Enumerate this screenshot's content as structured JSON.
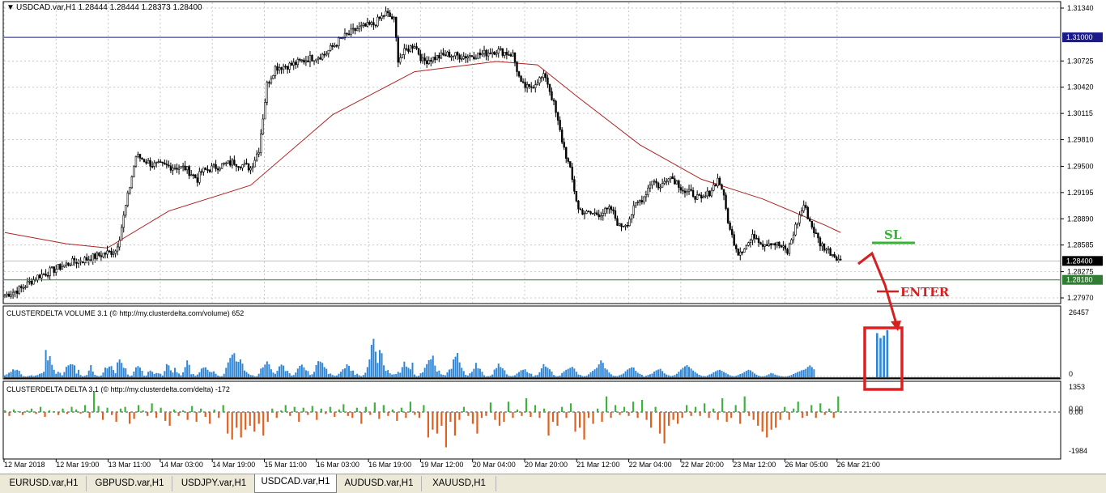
{
  "window": {
    "symbol_header": "USDCAD.var,H1  1.28444 1.28444 1.28373 1.28400"
  },
  "tabs": [
    {
      "label": "EURUSD.var,H1",
      "active": false
    },
    {
      "label": "GBPUSD.var,H1",
      "active": false
    },
    {
      "label": "USDJPY.var,H1",
      "active": false
    },
    {
      "label": "USDCAD.var,H1",
      "active": true
    },
    {
      "label": "AUDUSD.var,H1",
      "active": false
    },
    {
      "label": "XAUUSD,H1",
      "active": false
    }
  ],
  "chart_data": [
    {
      "type": "candlestick",
      "symbol": "USDCAD.var",
      "timeframe": "H1",
      "ohlc_last": {
        "open": 1.28444,
        "high": 1.28444,
        "low": 1.28373,
        "close": 1.284
      },
      "ylim": [
        1.2797,
        1.3134
      ],
      "y_ticks": [
        "1.31340",
        "1.31000",
        "1.30725",
        "1.30420",
        "1.30115",
        "1.29810",
        "1.29500",
        "1.29195",
        "1.28890",
        "1.28585",
        "1.28400",
        "1.28275",
        "1.28180",
        "1.27970"
      ],
      "x_ticks": [
        "12 Mar 2018",
        "12 Mar 19:00",
        "13 Mar 11:00",
        "14 Mar 03:00",
        "14 Mar 19:00",
        "15 Mar 11:00",
        "16 Mar 03:00",
        "16 Mar 19:00",
        "19 Mar 12:00",
        "20 Mar 04:00",
        "20 Mar 20:00",
        "21 Mar 12:00",
        "22 Mar 04:00",
        "22 Mar 20:00",
        "23 Mar 12:00",
        "26 Mar 05:00",
        "26 Mar 21:00"
      ],
      "close_path": [
        [
          0,
          1.28
        ],
        [
          8,
          1.2808
        ],
        [
          16,
          1.2822
        ],
        [
          24,
          1.283
        ],
        [
          32,
          1.2838
        ],
        [
          40,
          1.2842
        ],
        [
          48,
          1.2848
        ],
        [
          54,
          1.2852
        ],
        [
          56,
          1.2868
        ],
        [
          60,
          1.2915
        ],
        [
          64,
          1.2962
        ],
        [
          66,
          1.296
        ],
        [
          72,
          1.2952
        ],
        [
          80,
          1.295
        ],
        [
          88,
          1.2948
        ],
        [
          94,
          1.2935
        ],
        [
          96,
          1.2944
        ],
        [
          104,
          1.295
        ],
        [
          112,
          1.2955
        ],
        [
          120,
          1.2948
        ],
        [
          124,
          1.297
        ],
        [
          128,
          1.3045
        ],
        [
          132,
          1.3065
        ],
        [
          140,
          1.3068
        ],
        [
          148,
          1.3075
        ],
        [
          156,
          1.308
        ],
        [
          164,
          1.3098
        ],
        [
          172,
          1.311
        ],
        [
          180,
          1.3115
        ],
        [
          186,
          1.3128
        ],
        [
          190,
          1.312
        ],
        [
          192,
          1.3075
        ],
        [
          196,
          1.3085
        ],
        [
          200,
          1.3092
        ],
        [
          204,
          1.3072
        ],
        [
          208,
          1.3075
        ],
        [
          216,
          1.308
        ],
        [
          224,
          1.3078
        ],
        [
          232,
          1.308
        ],
        [
          240,
          1.3085
        ],
        [
          248,
          1.308
        ],
        [
          252,
          1.3045
        ],
        [
          256,
          1.304
        ],
        [
          260,
          1.305
        ],
        [
          264,
          1.3055
        ],
        [
          268,
          1.3022
        ],
        [
          272,
          1.298
        ],
        [
          276,
          1.2945
        ],
        [
          280,
          1.29
        ],
        [
          284,
          1.2895
        ],
        [
          290,
          1.2895
        ],
        [
          296,
          1.29
        ],
        [
          300,
          1.288
        ],
        [
          304,
          1.2885
        ],
        [
          308,
          1.2905
        ],
        [
          312,
          1.2915
        ],
        [
          316,
          1.2935
        ],
        [
          320,
          1.2925
        ],
        [
          324,
          1.294
        ],
        [
          328,
          1.2932
        ],
        [
          332,
          1.292
        ],
        [
          336,
          1.2918
        ],
        [
          340,
          1.291
        ],
        [
          344,
          1.292
        ],
        [
          348,
          1.2935
        ],
        [
          350,
          1.2925
        ],
        [
          354,
          1.2875
        ],
        [
          358,
          1.285
        ],
        [
          362,
          1.2858
        ],
        [
          366,
          1.287
        ],
        [
          370,
          1.286
        ],
        [
          374,
          1.2862
        ],
        [
          378,
          1.2858
        ],
        [
          382,
          1.285
        ],
        [
          386,
          1.288
        ],
        [
          390,
          1.2905
        ],
        [
          394,
          1.288
        ],
        [
          398,
          1.286
        ],
        [
          402,
          1.2852
        ],
        [
          406,
          1.2845
        ],
        [
          408,
          1.284
        ]
      ],
      "series": [
        {
          "name": "",
          "kind": "moving-average",
          "color": "#b22222",
          "values": [
            [
              0,
              1.2873
            ],
            [
              30,
              1.286
            ],
            [
              50,
              1.2855
            ],
            [
              80,
              1.2898
            ],
            [
              120,
              1.2928
            ],
            [
              160,
              1.301
            ],
            [
              200,
              1.306
            ],
            [
              240,
              1.3072
            ],
            [
              260,
              1.3068
            ],
            [
              280,
              1.303
            ],
            [
              310,
              1.2975
            ],
            [
              340,
              1.2935
            ],
            [
              370,
              1.2912
            ],
            [
              400,
              1.2882
            ],
            [
              408,
              1.2873
            ]
          ]
        }
      ],
      "levels": [
        {
          "value": 1.31,
          "color": "#1a1a8c",
          "label": "1.31000"
        },
        {
          "value": 1.284,
          "color": "#bfbfbf",
          "label": "1.28400"
        },
        {
          "value": 1.2818,
          "color": "#2e7d32",
          "label": "1.28180"
        }
      ],
      "annotations": [
        {
          "text": "SL",
          "color": "#36b336"
        },
        {
          "text": "ENTER",
          "color": "#d42020"
        }
      ]
    },
    {
      "type": "bar",
      "title": "CLUSTERDELTA VOLUME 3.1 (© http://my.clusterdelta.com/volume) 652",
      "ylim": [
        0,
        26457
      ],
      "y_ticks": [
        "26457",
        "0"
      ],
      "values": [
        800,
        1200,
        1800,
        2200,
        3200,
        2800,
        3000,
        2600,
        1200,
        400,
        300,
        400,
        600,
        800,
        500,
        700,
        900,
        1400,
        1600,
        2200,
        11000,
        6800,
        8500,
        5000,
        3000,
        1400,
        2200,
        1800,
        800,
        2100,
        4200,
        4800,
        5200,
        5200,
        4800,
        1500,
        3000,
        900,
        400,
        600,
        900,
        2700,
        4900,
        2300,
        1000,
        600,
        400,
        700,
        1900,
        3900,
        3600,
        4300,
        4500,
        2900,
        1600,
        6000,
        7200,
        5800,
        3800,
        3600,
        1100,
        500,
        700,
        2300,
        4000,
        4500,
        3900,
        2600,
        600,
        700,
        2200,
        2700,
        2200,
        1300,
        1700,
        1600,
        1400,
        700,
        2500,
        5300,
        4800,
        2800,
        1900,
        3800,
        2000,
        1500,
        800,
        2000,
        4100,
        6800,
        5000,
        1200,
        1300,
        600,
        1100,
        2000,
        3500,
        3900,
        4000,
        3000,
        2200,
        2100,
        2400,
        1400,
        700,
        400,
        400,
        1400,
        3800,
        6000,
        7800,
        9100,
        9700,
        6400,
        6200,
        7200,
        5500,
        2700,
        2100,
        1400,
        900,
        800,
        300,
        400,
        1400,
        3500,
        4000,
        5100,
        6400,
        5200,
        3200,
        1900,
        1400,
        2600,
        4400,
        5100,
        4700,
        2500,
        2600,
        1600,
        700,
        900,
        1900,
        3500,
        4600,
        5100,
        4000,
        2800,
        2500,
        900,
        1200,
        2200,
        4900,
        6500,
        6300,
        5800,
        4100,
        3400,
        1300,
        1500,
        900,
        600,
        700,
        1400,
        2200,
        3200,
        3600,
        5200,
        4600,
        2600,
        2700,
        1000,
        1400,
        800,
        400,
        900,
        1800,
        4100,
        7200,
        13100,
        15500,
        10300,
        5800,
        11000,
        9700,
        4800,
        2600,
        2900,
        1600,
        1100,
        1200,
        1300,
        2200,
        1800,
        4100,
        6300,
        4300,
        3800,
        3200,
        5900,
        1100,
        400,
        600,
        1600,
        2000,
        3800,
        5300,
        6900,
        7200,
        8700,
        4700,
        2300,
        2700,
        1200,
        1000,
        800,
        2000,
        3100,
        3400,
        7200,
        8300,
        9800,
        6000,
        3800,
        2500,
        1000,
        700,
        1600,
        2200,
        3400,
        5800,
        3600,
        3400,
        2200,
        800,
        300,
        400,
        600,
        1100,
        3100,
        3700,
        5500,
        4100,
        3600,
        2800,
        1200,
        600,
        400,
        600,
        800,
        1500,
        2100,
        2800,
        3000,
        3200,
        2100,
        1600,
        1400,
        300,
        800,
        900,
        2000,
        3600,
        5300,
        4300,
        3800,
        3200,
        2300,
        900,
        500,
        400,
        700,
        1700,
        2400,
        3000,
        3400,
        3800,
        4200,
        3500,
        2200,
        1100,
        900,
        500,
        400,
        600,
        1200,
        2000,
        2600,
        3200,
        3800,
        5200,
        6800,
        5800,
        3600,
        3100,
        1900,
        1200,
        600,
        500,
        400,
        800,
        1100,
        1500,
        2400,
        3100,
        3600,
        4000,
        3900,
        2600,
        1800,
        1400,
        1000,
        300,
        600,
        900,
        1200,
        1500,
        2300,
        2800,
        3100,
        3400,
        2500,
        1600,
        1100,
        800,
        500,
        600,
        900,
        1400,
        2200,
        3100,
        3800,
        4400,
        4900,
        4200,
        3500,
        2700,
        2100,
        1500,
        1000,
        600,
        500,
        400,
        700,
        1100,
        1400,
        2000,
        2400,
        2800,
        3000,
        2600,
        2100,
        1700,
        1200,
        800,
        500,
        400,
        600,
        900,
        1300,
        1600,
        2100,
        2600,
        3000,
        2800,
        2200,
        1500,
        1000,
        600,
        400,
        300,
        500,
        800,
        1200,
        1700,
        1500,
        1100,
        800,
        600,
        400,
        300,
        200,
        400,
        600,
        900,
        1300,
        1700,
        2100,
        2400,
        2800,
        3000,
        3400,
        4200,
        4800,
        4100,
        3200
      ],
      "projected_values": [
        17800,
        15800,
        16800,
        19000
      ],
      "highlight": {
        "color": "#e02020"
      }
    },
    {
      "type": "bar",
      "title": "CLUSTERDELTA DELTA 3.1 (© http://my.clusterdelta.com/delta) -172",
      "ylim": [
        -1984,
        1353
      ],
      "y_ticks": [
        "1353",
        "0.00",
        "0.00",
        "-1984"
      ],
      "values": [
        100,
        -200,
        150,
        50,
        -150,
        100,
        200,
        -100,
        300,
        -250,
        100,
        50,
        -150,
        200,
        -100,
        300,
        150,
        -80,
        400,
        -300,
        1200,
        350,
        -400,
        250,
        -150,
        -500,
        200,
        300,
        -600,
        -350,
        400,
        100,
        -200,
        500,
        -300,
        250,
        -450,
        -700,
        150,
        -200,
        100,
        -400,
        350,
        -500,
        200,
        -250,
        -600,
        150,
        -300,
        400,
        -1100,
        -1400,
        -800,
        -1300,
        -900,
        -700,
        -1000,
        -600,
        -1200,
        -500,
        200,
        -300,
        100,
        400,
        -200,
        300,
        -500,
        250,
        -150,
        350,
        -400,
        200,
        -100,
        300,
        -250,
        150,
        450,
        -200,
        -300,
        250,
        -600,
        300,
        -150,
        550,
        -350,
        400,
        -200,
        150,
        -450,
        250,
        -300,
        600,
        -150,
        -300,
        400,
        -1300,
        -900,
        -1100,
        -700,
        -1800,
        -500,
        -1200,
        -400,
        300,
        -200,
        -600,
        -1100,
        -300,
        -200,
        550,
        -400,
        -700,
        -500,
        600,
        -300,
        150,
        -200,
        800,
        -250,
        400,
        -300,
        200,
        -1200,
        -500,
        -700,
        300,
        -300,
        500,
        -1000,
        -800,
        -1400,
        -300,
        -600,
        200,
        -500,
        900,
        -300,
        400,
        -150,
        300,
        -200,
        600,
        -300,
        700,
        -400,
        -800,
        300,
        -1100,
        -1600,
        -700,
        -400,
        -600,
        -300,
        400,
        -200,
        300,
        -200,
        500,
        -300,
        200,
        -400,
        800,
        -500,
        -300,
        400,
        -600,
        900,
        -200,
        -400,
        -700,
        -1000,
        -1300,
        -900,
        -800,
        -400,
        300,
        -400,
        200,
        600,
        -300,
        -200,
        400,
        -300,
        500,
        -150,
        200,
        -300,
        900
      ],
      "projected_delta": [
        -250
      ]
    }
  ]
}
